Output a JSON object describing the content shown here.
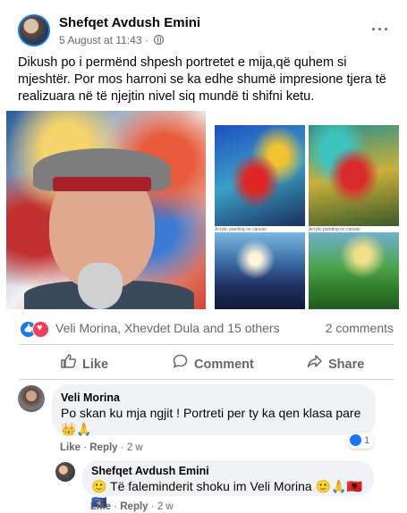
{
  "post": {
    "author": "Shefqet Avdush Emini",
    "date": "5 August at 11:43",
    "more": "···",
    "text": "Dikush po i permënd shpesh portretet e mija,që quhem si mjeshtër. Por mos harroni se ka edhe shumë impresione tjera të realizuara në të njejtin nivel siq mundë ti shifni ketu.",
    "painting_caption": "Acrylic painting on canvas"
  },
  "reactions": {
    "names": "Veli Morina, Xhevdet Dula and 15 others",
    "comments": "2 comments"
  },
  "actions": {
    "like": "Like",
    "comment": "Comment",
    "share": "Share"
  },
  "comments": [
    {
      "name": "Veli Morina",
      "text": "Po skan ku mja ngjit ! Portreti per ty ka qen klasa pare 👑🙏",
      "like": "Like",
      "reply": "Reply",
      "time": "2 w",
      "reaction_count": "1"
    },
    {
      "name": "Shefqet Avdush Emini",
      "text": "🙂 Të faleminderit shoku im Veli Morina 🙂🙏🇦🇱🇽🇰",
      "like": "Like",
      "reply": "Reply",
      "time": "2 w"
    }
  ],
  "colors": {
    "accent": "#1877f2",
    "love": "#f33e58",
    "secondary_text": "#65676b"
  }
}
